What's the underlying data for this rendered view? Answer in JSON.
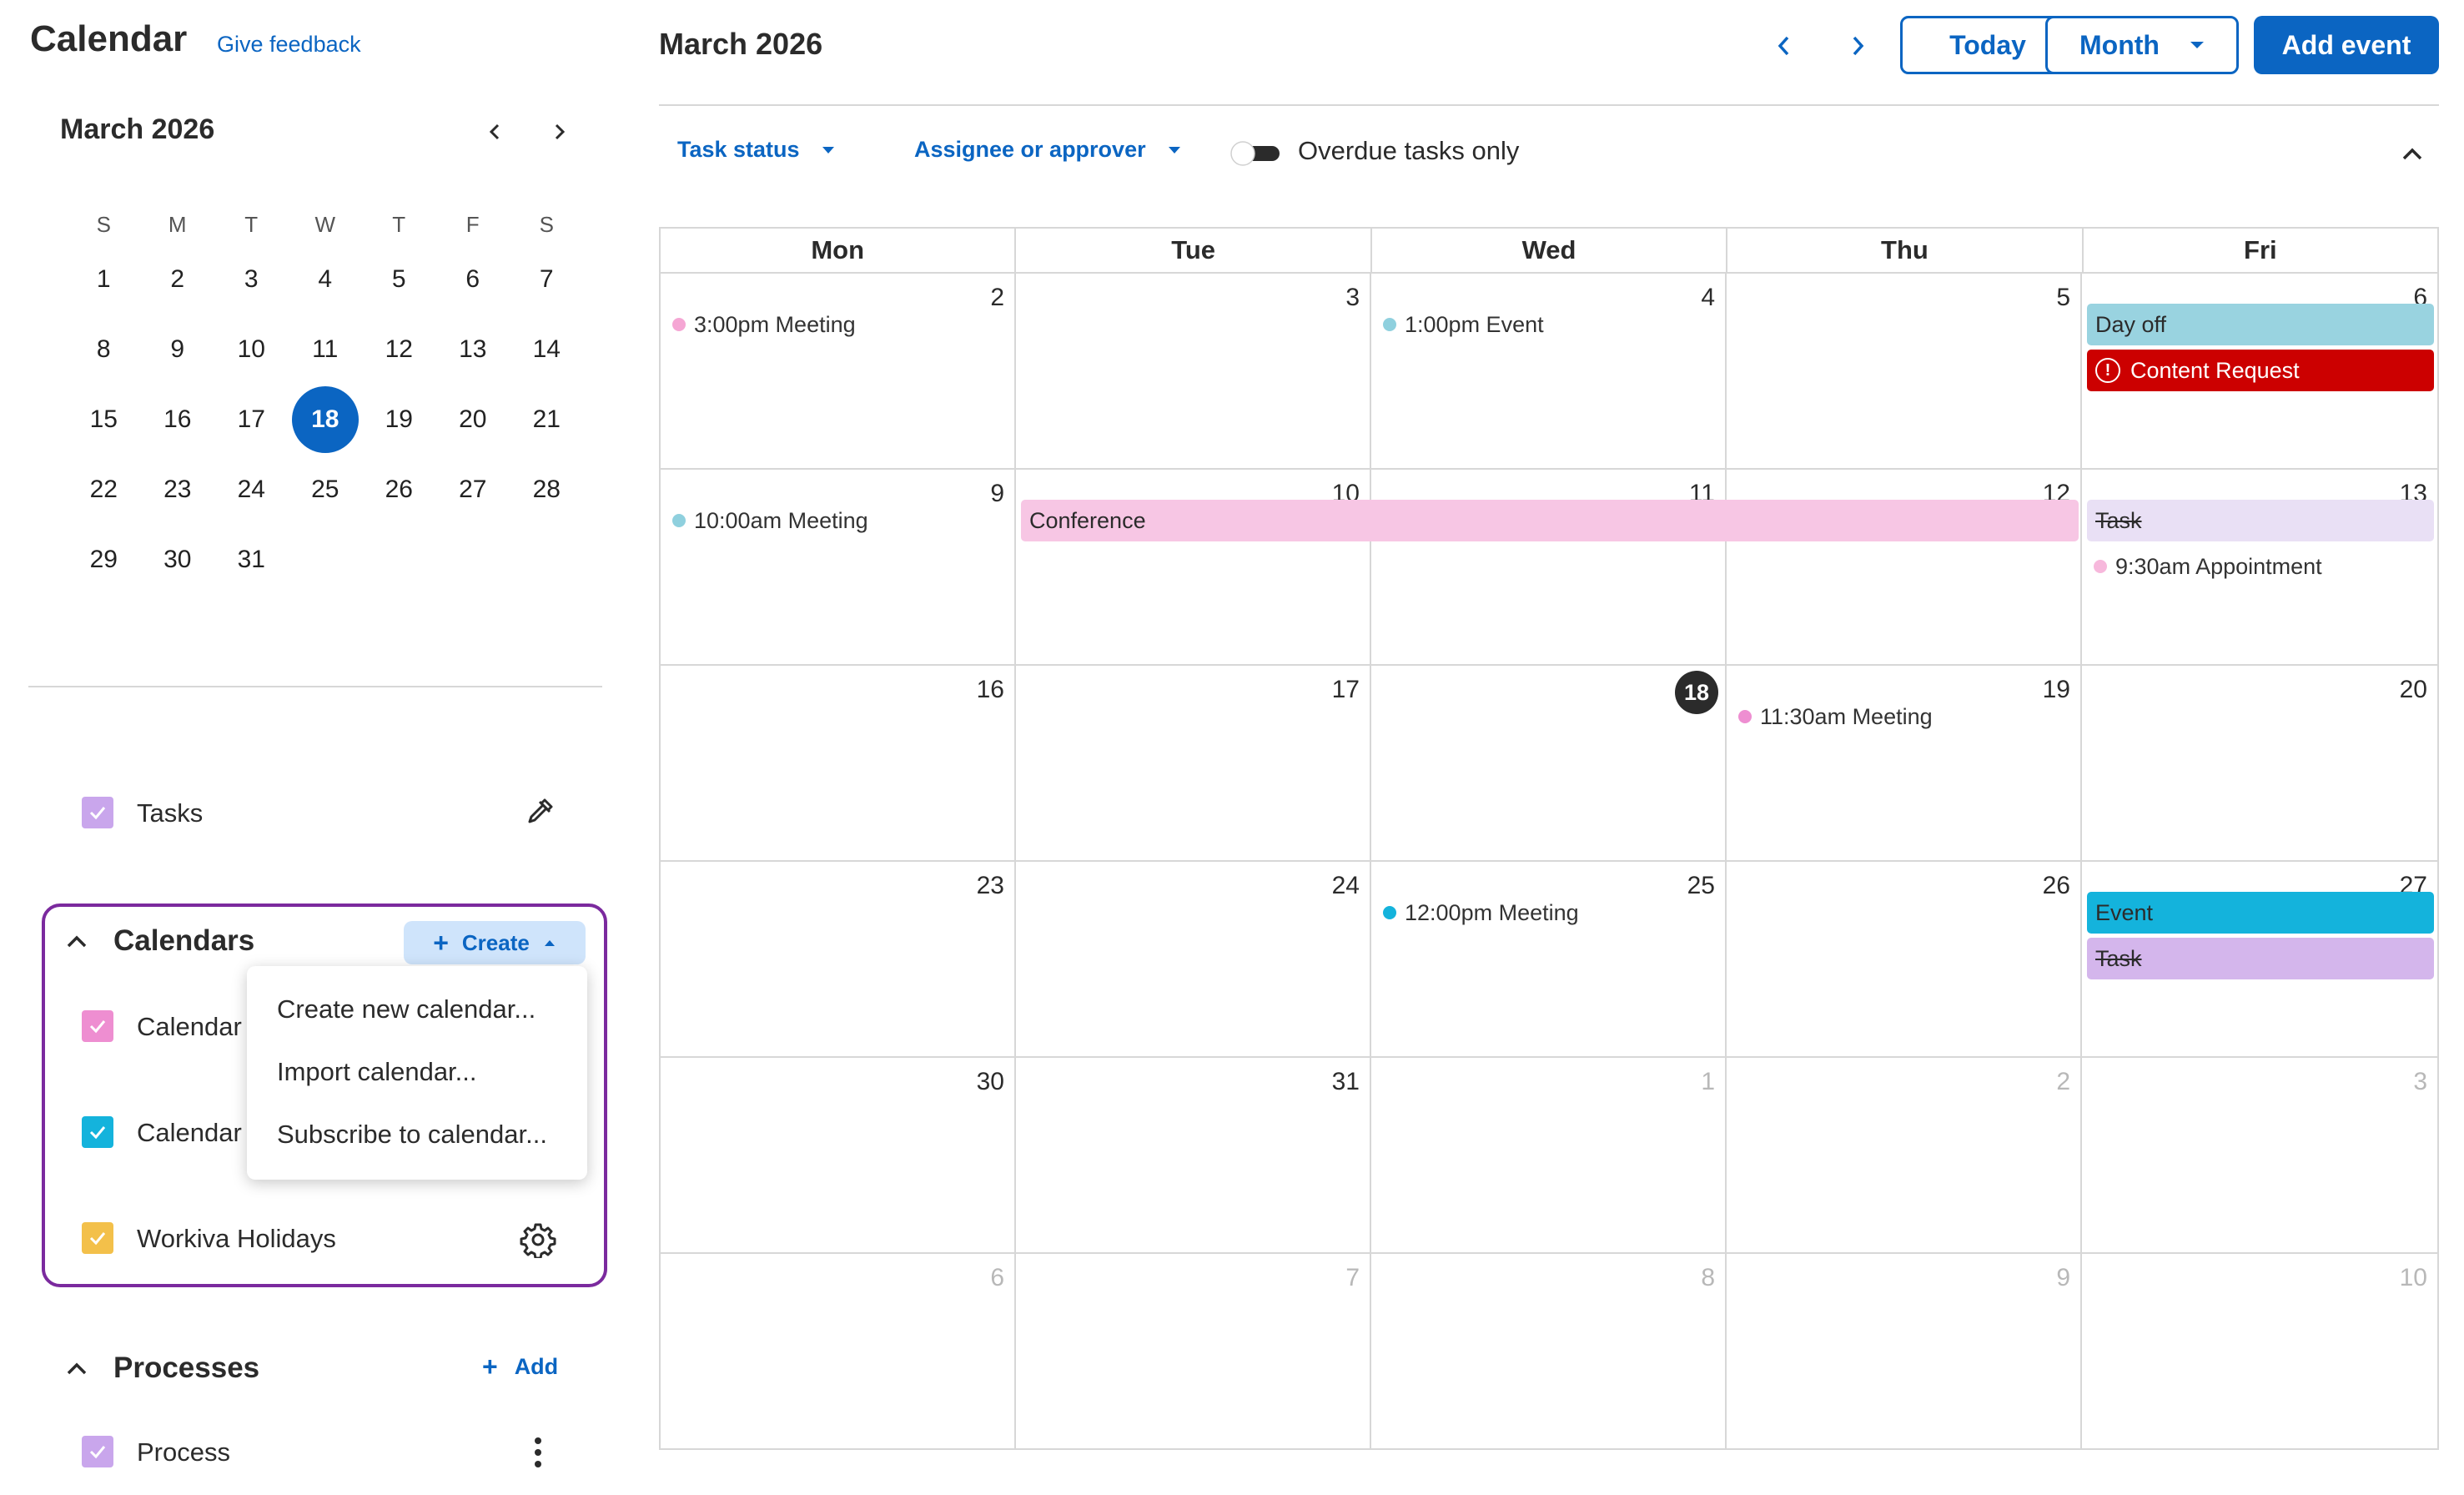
{
  "app": {
    "title": "Calendar",
    "feedback": "Give feedback"
  },
  "mini": {
    "month": "March 2026",
    "dow": [
      "S",
      "M",
      "T",
      "W",
      "T",
      "F",
      "S"
    ],
    "weeks": [
      [
        "1",
        "2",
        "3",
        "4",
        "5",
        "6",
        "7"
      ],
      [
        "8",
        "9",
        "10",
        "11",
        "12",
        "13",
        "14"
      ],
      [
        "15",
        "16",
        "17",
        "18",
        "19",
        "20",
        "21"
      ],
      [
        "22",
        "23",
        "24",
        "25",
        "26",
        "27",
        "28"
      ],
      [
        "29",
        "30",
        "31",
        "",
        "",
        "",
        ""
      ]
    ],
    "today": "18"
  },
  "sidebar": {
    "tasks_label": "Tasks",
    "calendars": {
      "title": "Calendars",
      "create_label": "Create",
      "items": [
        {
          "label": "Calendar",
          "color": "#ee8ed1"
        },
        {
          "label": "Calendar",
          "color": "#14b3dc"
        },
        {
          "label": "Workiva Holidays",
          "color": "#f3c04a"
        }
      ],
      "menu": [
        "Create new calendar...",
        "Import calendar...",
        "Subscribe to calendar..."
      ]
    },
    "processes": {
      "title": "Processes",
      "add_label": "Add",
      "items": [
        {
          "label": "Process"
        }
      ]
    }
  },
  "toolbar": {
    "month_label": "March 2026",
    "today_label": "Today",
    "view_label": "Month",
    "add_event_label": "Add event"
  },
  "filters": {
    "task_status": "Task status",
    "assignee": "Assignee or approver",
    "overdue": "Overdue tasks only",
    "overdue_on": false
  },
  "calendar": {
    "headers": [
      "Mon",
      "Tue",
      "Wed",
      "Thu",
      "Fri"
    ],
    "weeks": [
      [
        {
          "d": "2"
        },
        {
          "d": "3"
        },
        {
          "d": "4"
        },
        {
          "d": "5"
        },
        {
          "d": "6"
        }
      ],
      [
        {
          "d": "9"
        },
        {
          "d": "10"
        },
        {
          "d": "11"
        },
        {
          "d": "12"
        },
        {
          "d": "13"
        }
      ],
      [
        {
          "d": "16"
        },
        {
          "d": "17"
        },
        {
          "d": "18",
          "today": true
        },
        {
          "d": "19"
        },
        {
          "d": "20"
        }
      ],
      [
        {
          "d": "23"
        },
        {
          "d": "24"
        },
        {
          "d": "25"
        },
        {
          "d": "26"
        },
        {
          "d": "27"
        }
      ],
      [
        {
          "d": "30"
        },
        {
          "d": "31"
        },
        {
          "d": "1",
          "other": true
        },
        {
          "d": "2",
          "other": true
        },
        {
          "d": "3",
          "other": true
        }
      ],
      [
        {
          "d": "6",
          "other": true
        },
        {
          "d": "7",
          "other": true
        },
        {
          "d": "8",
          "other": true
        },
        {
          "d": "9",
          "other": true
        },
        {
          "d": "10",
          "other": true
        }
      ]
    ],
    "events": {
      "mon2": {
        "label": "3:00pm Meeting",
        "color": "#f5a6d4"
      },
      "wed4": {
        "label": "1:00pm Event",
        "color": "#8fd0de"
      },
      "fri6_dayoff": {
        "label": "Day off",
        "color": "#99d3e0"
      },
      "fri6_request": {
        "label": "Content Request",
        "color": "#cc0000"
      },
      "mon9": {
        "label": "10:00am Meeting",
        "color": "#8fd0de"
      },
      "conference": {
        "label": "Conference",
        "color": "#f7c6e4"
      },
      "fri13_task": {
        "label": "Task",
        "color": "#e9e0f5"
      },
      "fri13_appt": {
        "label": "9:30am Appointment",
        "color": "#f7b8dc"
      },
      "thu19": {
        "label": "11:30am Meeting",
        "color": "#ee8ed1"
      },
      "wed25": {
        "label": "12:00pm Meeting",
        "color": "#14b3dc"
      },
      "fri27_event": {
        "label": "Event",
        "color": "#14b3dc"
      },
      "fri27_task": {
        "label": "Task",
        "color": "#d4b6ec"
      }
    }
  },
  "colors": {
    "accent": "#0b65c2",
    "highlight_border": "#7b2a9e",
    "task_check": "#c9a6ec",
    "process_check": "#c9a6ec"
  }
}
